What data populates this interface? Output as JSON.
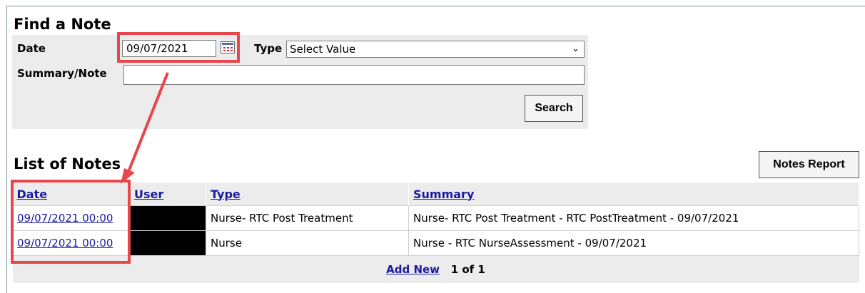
{
  "find": {
    "title": "Find a Note",
    "date_label": "Date",
    "date_value": "09/07/2021",
    "type_label": "Type",
    "type_value": "Select Value",
    "summary_label": "Summary/Note",
    "summary_value": "",
    "search_button": "Search"
  },
  "list": {
    "title": "List of Notes",
    "report_button": "Notes Report",
    "columns": [
      "Date",
      "User",
      "Type",
      "Summary"
    ],
    "rows": [
      {
        "date": "09/07/2021 00:00",
        "user": "",
        "type": "Nurse- RTC Post Treatment",
        "summary": "Nurse- RTC Post Treatment - RTC PostTreatment - 09/07/2021"
      },
      {
        "date": "09/07/2021 00:00",
        "user": "",
        "type": "Nurse",
        "summary": "Nurse - RTC NurseAssessment - 09/07/2021"
      }
    ],
    "add_new": "Add New",
    "pager": "1 of 1"
  },
  "colors": {
    "highlight": "#e5474b",
    "link": "#1a1aa0",
    "panel": "#ececec"
  },
  "icons": {
    "calendar": "calendar-icon",
    "dropdown": "chevron-down-icon"
  }
}
